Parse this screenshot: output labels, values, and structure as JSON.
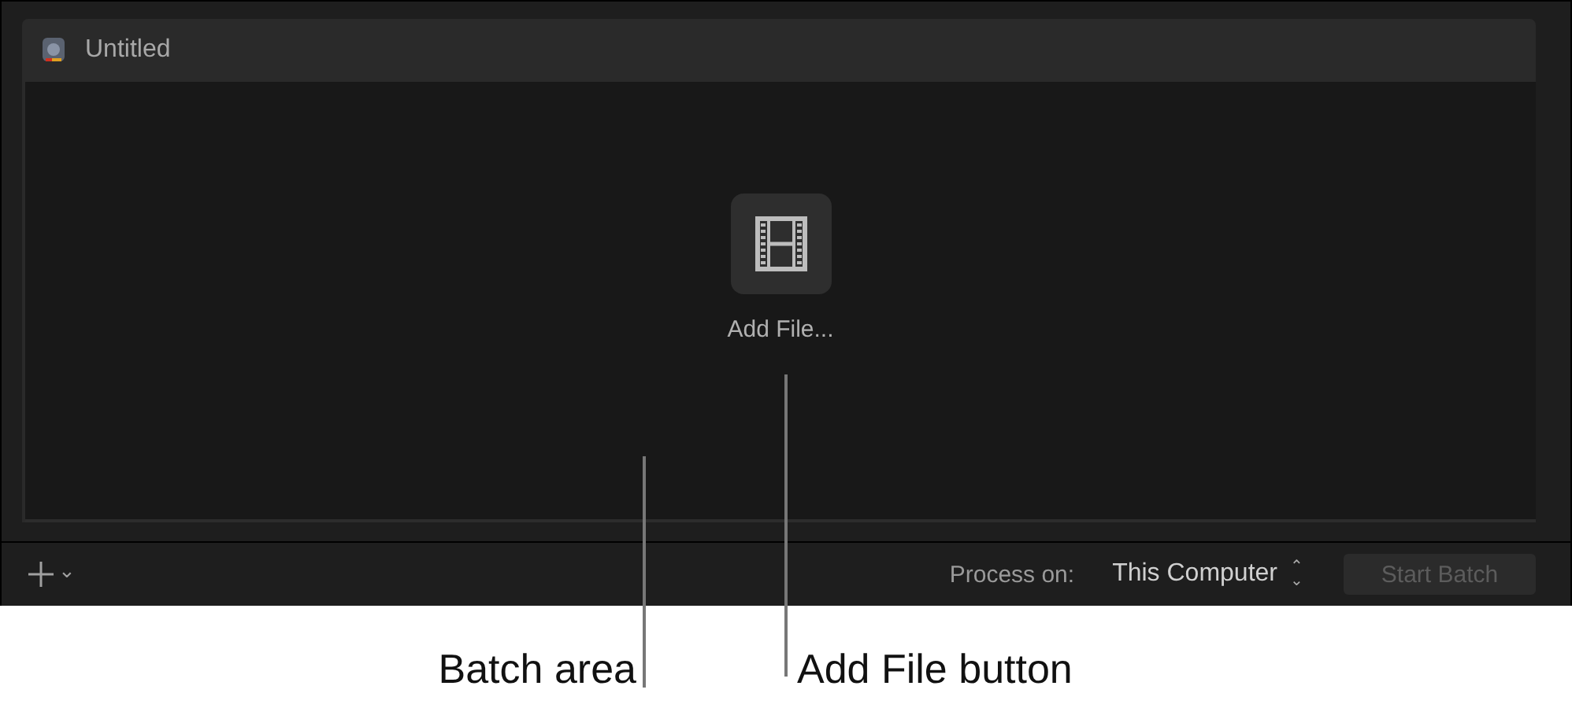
{
  "batch": {
    "title": "Untitled",
    "add_file_label": "Add File..."
  },
  "bottom_bar": {
    "add_caret": "⌄",
    "process_label": "Process on:",
    "process_value": "This Computer",
    "process_arrows": "⌃⌄",
    "start_button": {
      "label": "Start Batch",
      "disabled": true
    }
  },
  "callouts": [
    {
      "kind": "batch",
      "text": "Batch area"
    },
    {
      "kind": "add",
      "text": "Add File button"
    }
  ]
}
